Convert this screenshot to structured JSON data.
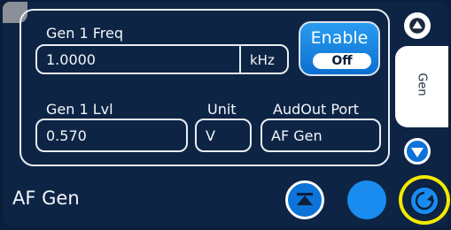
{
  "freq": {
    "label": "Gen 1 Freq",
    "value": "1.0000",
    "unit": "kHz"
  },
  "enable": {
    "label": "Enable",
    "state": "Off"
  },
  "level": {
    "label": "Gen 1 Lvl",
    "value": "0.570"
  },
  "unit": {
    "label": "Unit",
    "value": "V"
  },
  "port": {
    "label": "AudOut Port",
    "value": "AF Gen"
  },
  "side_tab": {
    "label": "Gen"
  },
  "footer": {
    "title": "AF Gen"
  },
  "colors": {
    "accent": "#0d73d8",
    "highlight": "#f4ea00",
    "background": "#0d2444"
  },
  "icons": [
    "scroll-up-icon",
    "scroll-down-icon",
    "eject-icon",
    "circle-icon",
    "refresh-icon"
  ]
}
